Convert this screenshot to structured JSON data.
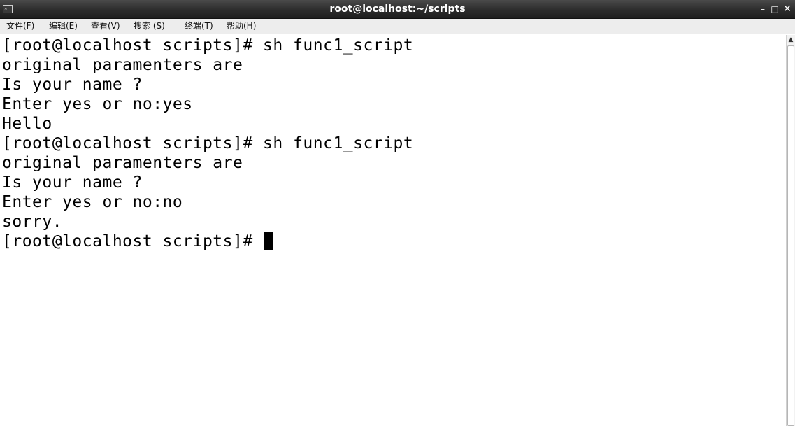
{
  "window": {
    "title": "root@localhost:~/scripts",
    "icon_label": "∗",
    "controls": {
      "minimize": "–",
      "maximize": "□",
      "close": "✕"
    }
  },
  "menu": {
    "items": [
      {
        "label": "文件(F)"
      },
      {
        "label": "编辑(E)"
      },
      {
        "label": "查看(V)"
      },
      {
        "label": "搜索 (S)"
      },
      {
        "label": "终端(T)"
      },
      {
        "label": "帮助(H)"
      }
    ]
  },
  "terminal": {
    "lines": [
      "[root@localhost scripts]# sh func1_script",
      "original paramenters are",
      "Is your name ?",
      "Enter yes or no:yes",
      "Hello",
      "[root@localhost scripts]# sh func1_script",
      "original paramenters are",
      "Is your name ?",
      "Enter yes or no:no",
      "sorry.",
      "[root@localhost scripts]# "
    ]
  },
  "scrollbar": {
    "up_arrow": "▲"
  }
}
